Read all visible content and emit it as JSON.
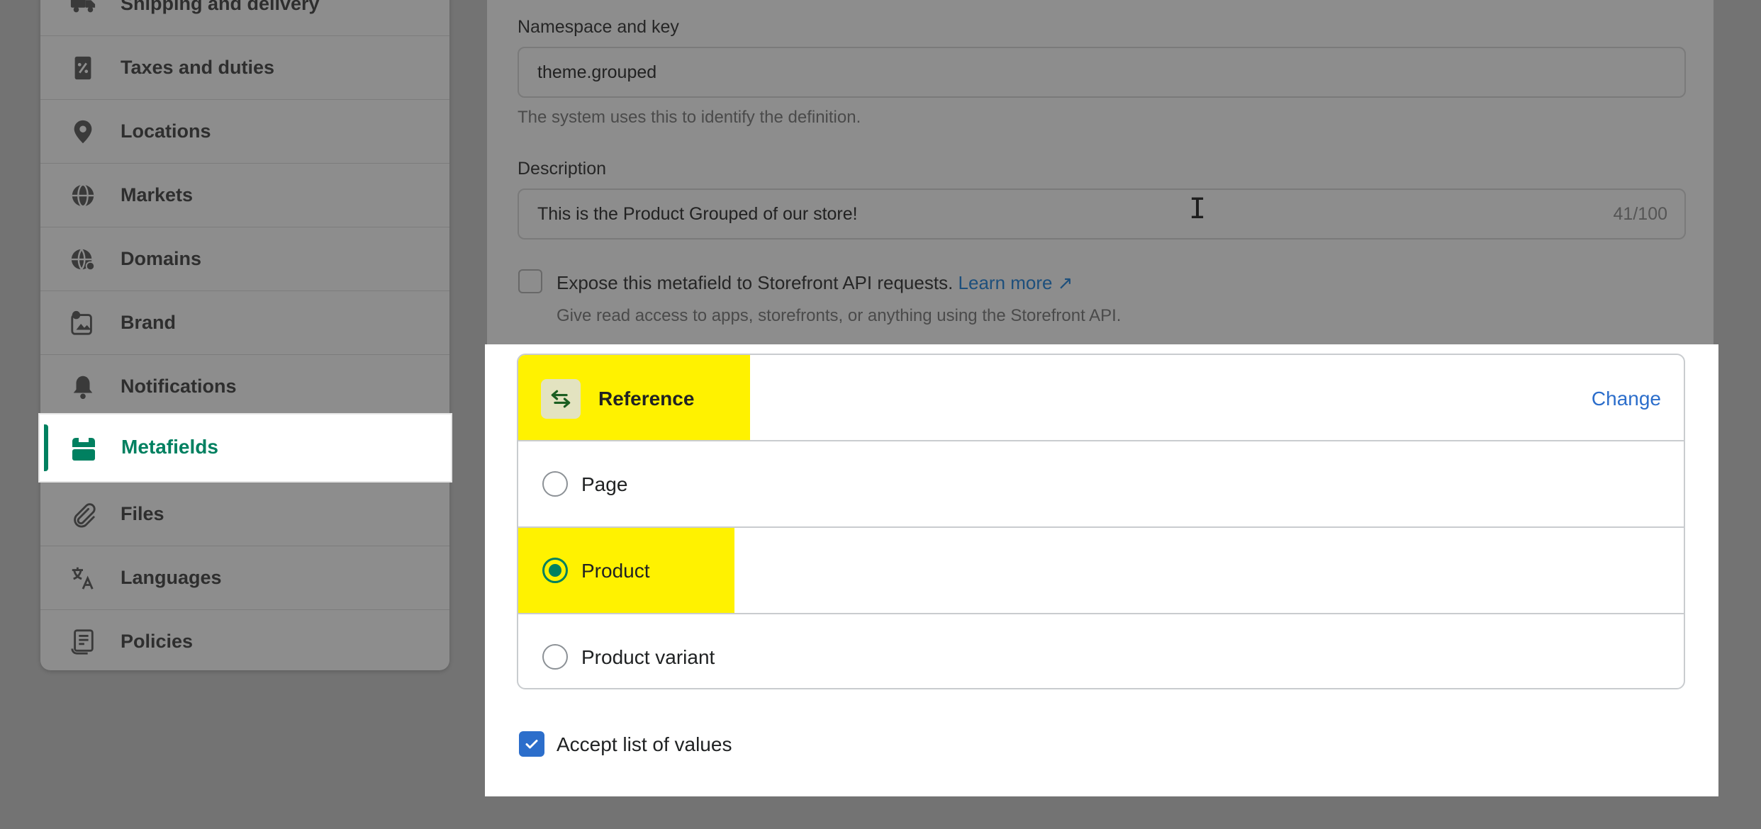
{
  "sidebar": {
    "items": [
      {
        "label": "Shipping and delivery",
        "icon": "truck-icon"
      },
      {
        "label": "Taxes and duties",
        "icon": "receipt-icon"
      },
      {
        "label": "Locations",
        "icon": "location-pin-icon"
      },
      {
        "label": "Markets",
        "icon": "globe-icon"
      },
      {
        "label": "Domains",
        "icon": "domain-globe-icon"
      },
      {
        "label": "Brand",
        "icon": "brand-icon"
      },
      {
        "label": "Notifications",
        "icon": "bell-icon"
      },
      {
        "label": "Metafields",
        "icon": "metafields-icon",
        "active": true
      },
      {
        "label": "Files",
        "icon": "paperclip-icon"
      },
      {
        "label": "Languages",
        "icon": "translate-icon"
      },
      {
        "label": "Policies",
        "icon": "policy-icon"
      }
    ]
  },
  "form": {
    "namespace_label": "Namespace and key",
    "namespace_value": "theme.grouped",
    "namespace_help": "The system uses this to identify the definition.",
    "description_label": "Description",
    "description_value": "This is the Product Grouped of our store!",
    "description_counter": "41/100",
    "expose_label": "Expose this metafield to Storefront API requests.",
    "learn_more": "Learn more",
    "expose_help": "Give read access to apps, storefronts, or anything using the Storefront API."
  },
  "type_panel": {
    "type_title": "Reference",
    "change_label": "Change",
    "options": [
      {
        "label": "Page",
        "selected": false
      },
      {
        "label": "Product",
        "selected": true
      },
      {
        "label": "Product variant",
        "selected": false
      }
    ],
    "accept_list_label": "Accept list of values",
    "accept_list_checked": true
  },
  "colors": {
    "accent_green": "#008060",
    "link_blue": "#2c6ecb",
    "highlight_yellow": "#fff200",
    "overlay_gray": "#737373"
  }
}
